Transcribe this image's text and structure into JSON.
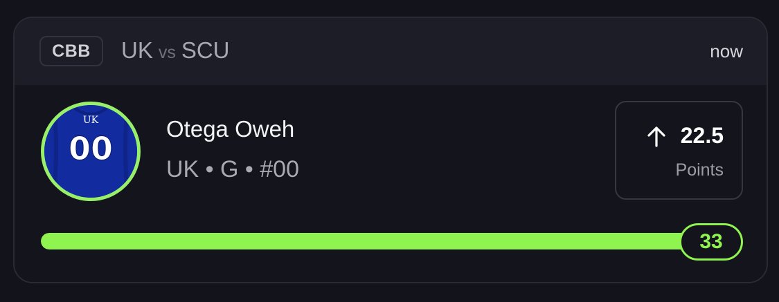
{
  "header": {
    "league_badge": "CBB",
    "home_team": "UK",
    "vs_text": "vs",
    "away_team": "SCU",
    "time": "now"
  },
  "player": {
    "name": "Otega Oweh",
    "meta": "UK • G • #00",
    "jersey_team": "UK",
    "jersey_number": "00",
    "avatar_icon": "jersey-icon"
  },
  "line": {
    "direction_icon": "arrow-up-icon",
    "value": "22.5",
    "stat": "Points"
  },
  "progress": {
    "current_value": "33",
    "fill_fraction": 1.0
  },
  "colors": {
    "accent": "#8ff44f",
    "jersey": "#122b9e",
    "background": "#14141d"
  }
}
